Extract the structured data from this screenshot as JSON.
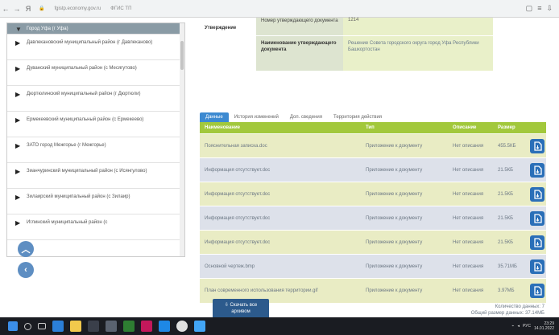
{
  "browser": {
    "address": "fgistp.economy.gov.ru",
    "page_title": "ФГИС ТП"
  },
  "sidebar": {
    "items": [
      {
        "label": "Город Уфа (г Уфа)",
        "active": true
      },
      {
        "label": "Давлекановский муниципальный район (г Давлеканово)",
        "active": false
      },
      {
        "label": "Дуванский муниципальный район (с Месягутово)",
        "active": false
      },
      {
        "label": "Дюртюлинский муниципальный район (г Дюртюли)",
        "active": false
      },
      {
        "label": "Ермекеевский муниципальный район (с Ермекеево)",
        "active": false
      },
      {
        "label": "ЗАТО город Межгорье (г Межгорье)",
        "active": false
      },
      {
        "label": "Зианчуринский муниципальный район (с Исянгулово)",
        "active": false
      },
      {
        "label": "Зилаирский муниципальный район (с Зилаир)",
        "active": false
      },
      {
        "label": "Иглинский муниципальный район (с",
        "active": false
      }
    ]
  },
  "info": {
    "label": "Утверждение",
    "row1_key": "Номер утверждающего документа",
    "row1_val": "1214",
    "row2_key": "Наименование утверждающего документа",
    "row2_val": "Решение Совета городского округа город Уфа Республики Башкортостан"
  },
  "tabs": [
    {
      "label": "Данные",
      "active": true
    },
    {
      "label": "История изменений",
      "active": false
    },
    {
      "label": "Доп. сведения",
      "active": false
    },
    {
      "label": "Территория действия",
      "active": false
    }
  ],
  "table": {
    "headers": [
      "Наименование",
      "Тип",
      "Описание",
      "Размер"
    ],
    "rows": [
      {
        "name": "Пояснительная записка.doc",
        "type": "Приложение к документу",
        "desc": "Нет описания",
        "size": "455.5КБ"
      },
      {
        "name": "Информация отсутствует.doc",
        "type": "Приложение к документу",
        "desc": "Нет описания",
        "size": "21.5КБ"
      },
      {
        "name": "Информация отсутствует.doc",
        "type": "Приложение к документу",
        "desc": "Нет описания",
        "size": "21.5КБ"
      },
      {
        "name": "Информация отсутствует.doc",
        "type": "Приложение к документу",
        "desc": "Нет описания",
        "size": "21.5КБ"
      },
      {
        "name": "Информация отсутствует.doc",
        "type": "Приложение к документу",
        "desc": "Нет описания",
        "size": "21.5КБ"
      },
      {
        "name": "Основной чертеж.bmp",
        "type": "Приложение к документу",
        "desc": "Нет описания",
        "size": "35.71МБ"
      },
      {
        "name": "План современного использования территории.gif",
        "type": "Приложение к документу",
        "desc": "Нет описания",
        "size": "3.97МБ"
      }
    ]
  },
  "summary": {
    "count": "Количество данных: 7",
    "total": "Общий размер данных: 37.14МБ"
  },
  "download_all": {
    "line1": "Скачать все",
    "line2": "архивом"
  },
  "taskbar": {
    "lang": "РУС",
    "time": "23:29",
    "date": "14.01.2022"
  },
  "colors": {
    "header_green": "#a2c83c",
    "tab_blue": "#3d8ad1",
    "download_blue": "#2a6fb8",
    "sidebar_active": "#8a9ba5"
  }
}
